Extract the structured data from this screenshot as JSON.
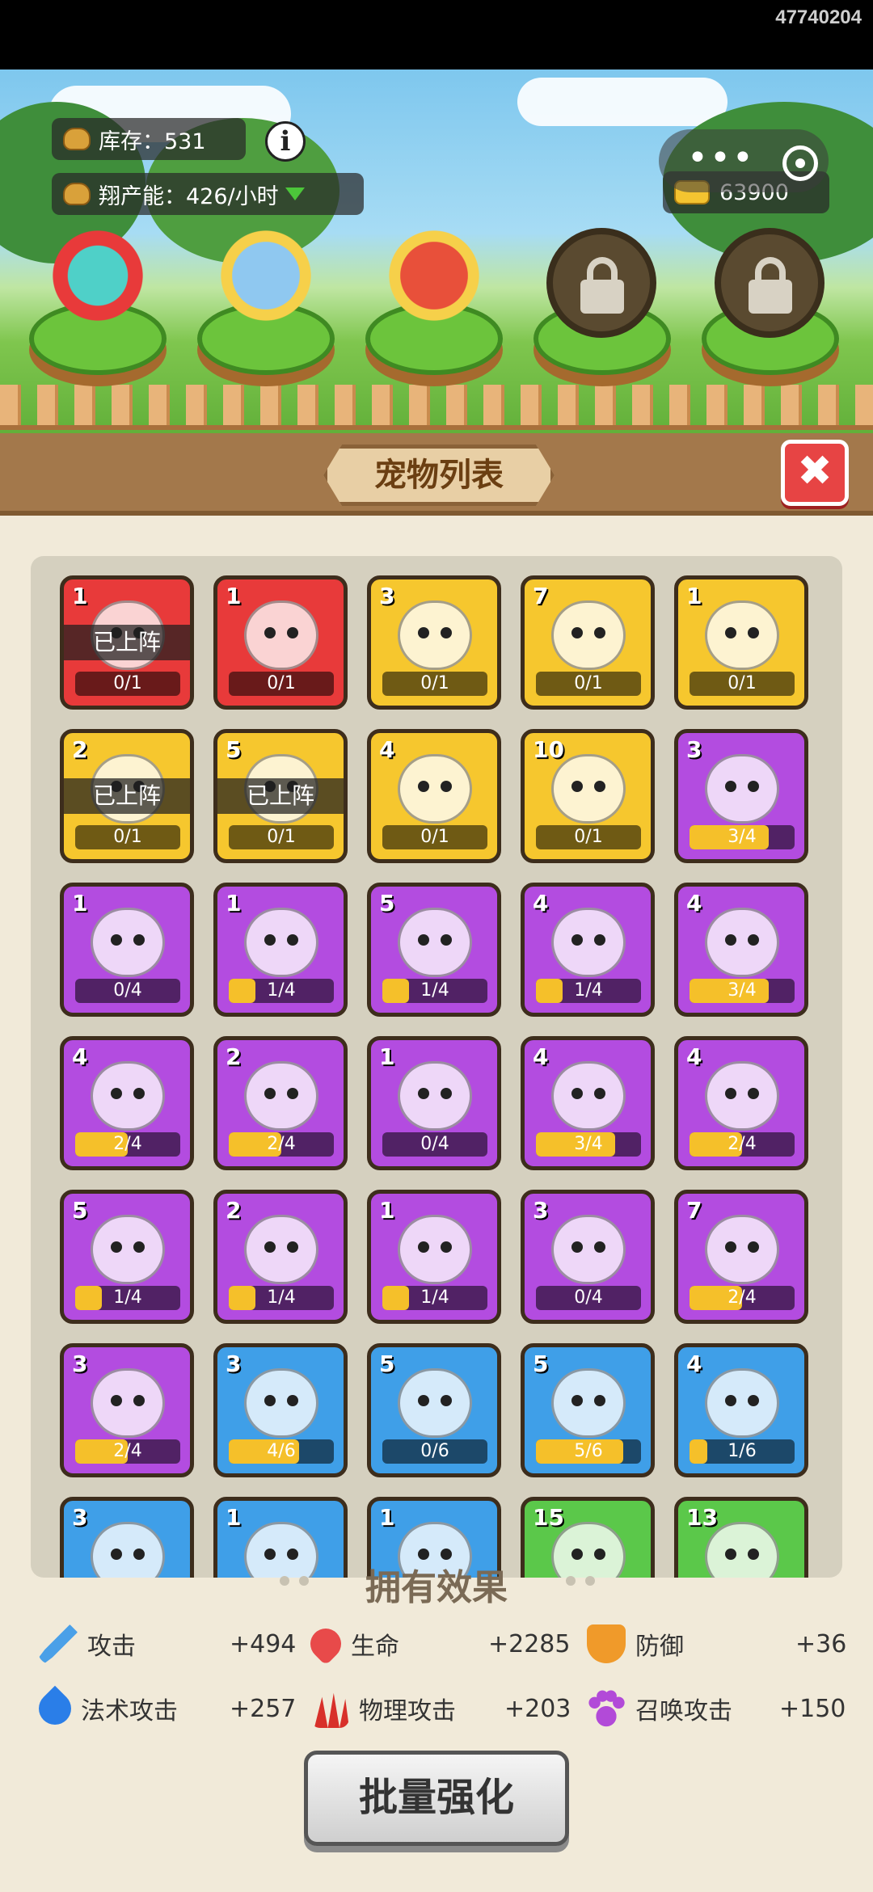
{
  "window_id": "47740204",
  "hud": {
    "stock_label": "库存：531",
    "rate_label": "翔产能：426/小时",
    "gold": "63900",
    "info_glyph": "i"
  },
  "panel": {
    "title": "宠物列表",
    "close_glyph": "✖"
  },
  "deployed_label": "已上阵",
  "pets": [
    {
      "level": "1",
      "progress": "0/1",
      "fraction": 0,
      "color": "red",
      "deployed": true
    },
    {
      "level": "1",
      "progress": "0/1",
      "fraction": 0,
      "color": "red",
      "deployed": false
    },
    {
      "level": "3",
      "progress": "0/1",
      "fraction": 0,
      "color": "yellow",
      "deployed": false
    },
    {
      "level": "7",
      "progress": "0/1",
      "fraction": 0,
      "color": "yellow",
      "deployed": false
    },
    {
      "level": "1",
      "progress": "0/1",
      "fraction": 0,
      "color": "yellow",
      "deployed": false
    },
    {
      "level": "2",
      "progress": "0/1",
      "fraction": 0,
      "color": "yellow",
      "deployed": true
    },
    {
      "level": "5",
      "progress": "0/1",
      "fraction": 0,
      "color": "yellow",
      "deployed": true
    },
    {
      "level": "4",
      "progress": "0/1",
      "fraction": 0,
      "color": "yellow",
      "deployed": false
    },
    {
      "level": "10",
      "progress": "0/1",
      "fraction": 0,
      "color": "yellow",
      "deployed": false
    },
    {
      "level": "3",
      "progress": "3/4",
      "fraction": 0.75,
      "color": "purple",
      "deployed": false
    },
    {
      "level": "1",
      "progress": "0/4",
      "fraction": 0,
      "color": "purple",
      "deployed": false
    },
    {
      "level": "1",
      "progress": "1/4",
      "fraction": 0.25,
      "color": "purple",
      "deployed": false
    },
    {
      "level": "5",
      "progress": "1/4",
      "fraction": 0.25,
      "color": "purple",
      "deployed": false
    },
    {
      "level": "4",
      "progress": "1/4",
      "fraction": 0.25,
      "color": "purple",
      "deployed": false
    },
    {
      "level": "4",
      "progress": "3/4",
      "fraction": 0.75,
      "color": "purple",
      "deployed": false
    },
    {
      "level": "4",
      "progress": "2/4",
      "fraction": 0.5,
      "color": "purple",
      "deployed": false
    },
    {
      "level": "2",
      "progress": "2/4",
      "fraction": 0.5,
      "color": "purple",
      "deployed": false
    },
    {
      "level": "1",
      "progress": "0/4",
      "fraction": 0,
      "color": "purple",
      "deployed": false
    },
    {
      "level": "4",
      "progress": "3/4",
      "fraction": 0.75,
      "color": "purple",
      "deployed": false
    },
    {
      "level": "4",
      "progress": "2/4",
      "fraction": 0.5,
      "color": "purple",
      "deployed": false
    },
    {
      "level": "5",
      "progress": "1/4",
      "fraction": 0.25,
      "color": "purple",
      "deployed": false
    },
    {
      "level": "2",
      "progress": "1/4",
      "fraction": 0.25,
      "color": "purple",
      "deployed": false
    },
    {
      "level": "1",
      "progress": "1/4",
      "fraction": 0.25,
      "color": "purple",
      "deployed": false
    },
    {
      "level": "3",
      "progress": "0/4",
      "fraction": 0,
      "color": "purple",
      "deployed": false
    },
    {
      "level": "7",
      "progress": "2/4",
      "fraction": 0.5,
      "color": "purple",
      "deployed": false
    },
    {
      "level": "3",
      "progress": "2/4",
      "fraction": 0.5,
      "color": "purple",
      "deployed": false
    },
    {
      "level": "3",
      "progress": "4/6",
      "fraction": 0.667,
      "color": "blue",
      "deployed": false
    },
    {
      "level": "5",
      "progress": "0/6",
      "fraction": 0,
      "color": "blue",
      "deployed": false
    },
    {
      "level": "5",
      "progress": "5/6",
      "fraction": 0.833,
      "color": "blue",
      "deployed": false
    },
    {
      "level": "4",
      "progress": "1/6",
      "fraction": 0.167,
      "color": "blue",
      "deployed": false
    },
    {
      "level": "3",
      "progress": "",
      "fraction": 0,
      "color": "blue",
      "deployed": false
    },
    {
      "level": "1",
      "progress": "",
      "fraction": 0,
      "color": "blue",
      "deployed": false
    },
    {
      "level": "1",
      "progress": "",
      "fraction": 0,
      "color": "blue",
      "deployed": false
    },
    {
      "level": "15",
      "progress": "",
      "fraction": 0,
      "color": "green",
      "deployed": false
    },
    {
      "level": "13",
      "progress": "",
      "fraction": 0,
      "color": "green",
      "deployed": false
    }
  ],
  "effects": {
    "title": "拥有效果",
    "items": [
      {
        "label": "攻击",
        "value": "+494",
        "icon": "sword-icon",
        "color": "#4aa0e8"
      },
      {
        "label": "生命",
        "value": "+2285",
        "icon": "heart-icon",
        "color": "#e84a4a"
      },
      {
        "label": "防御",
        "value": "+36",
        "icon": "shield-icon",
        "color": "#f09a2a"
      },
      {
        "label": "法术攻击",
        "value": "+257",
        "icon": "flame-icon",
        "color": "#2a7ee8"
      },
      {
        "label": "物理攻击",
        "value": "+203",
        "icon": "claw-icon",
        "color": "#d8302a"
      },
      {
        "label": "召唤攻击",
        "value": "+150",
        "icon": "paw-icon",
        "color": "#b24ad8"
      }
    ]
  },
  "batch_button": "批量强化"
}
